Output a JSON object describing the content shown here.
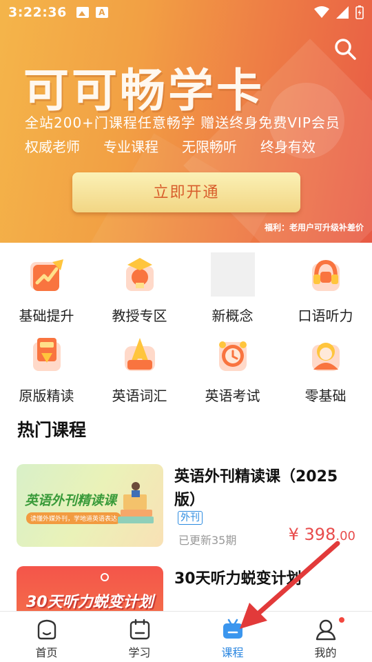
{
  "status_bar": {
    "time": "3:22:36"
  },
  "banner": {
    "title": "可可畅学卡",
    "subtitle": "全站200+门课程任意畅学   赠送终身免费VIP会员",
    "features": [
      "权威老师",
      "专业课程",
      "无限畅听",
      "终身有效"
    ],
    "button_label": "立即开通",
    "note": "福利：老用户可升级补差价"
  },
  "categories": [
    {
      "label": "基础提升",
      "icon": "growth-chart-icon"
    },
    {
      "label": "教授专区",
      "icon": "professor-icon"
    },
    {
      "label": "新概念",
      "icon": "placeholder-image"
    },
    {
      "label": "口语听力",
      "icon": "headset-icon"
    },
    {
      "label": "原版精读",
      "icon": "bookmark-icon"
    },
    {
      "label": "英语词汇",
      "icon": "letter-a-icon"
    },
    {
      "label": "英语考试",
      "icon": "alarm-clock-icon"
    },
    {
      "label": "零基础",
      "icon": "beginner-avatar-icon"
    }
  ],
  "section": {
    "title": "热门课程"
  },
  "courses": [
    {
      "title": "英语外刊精读课（2025版）",
      "tag": "外刊",
      "updated": "已更新35期",
      "price_main": "¥ 398",
      "price_cents": ".00",
      "thumb_title": "英语外刊精读课",
      "thumb_subtitle": "读懂外媒外刊，学地道英语表达"
    },
    {
      "title": "30天听力蜕变计划",
      "thumb_title": "30天听力蜕变计划"
    }
  ],
  "tabs": [
    {
      "label": "首页",
      "icon": "home-icon",
      "active": false
    },
    {
      "label": "学习",
      "icon": "study-icon",
      "active": false
    },
    {
      "label": "课程",
      "icon": "course-tv-icon",
      "active": true
    },
    {
      "label": "我的",
      "icon": "profile-icon",
      "active": false,
      "badge": true
    }
  ],
  "colors": {
    "accent": "#2a86e0",
    "price": "#e84b4b",
    "banner_start": "#f4b54a",
    "banner_end": "#e85a45",
    "badge": "#f2473e"
  }
}
